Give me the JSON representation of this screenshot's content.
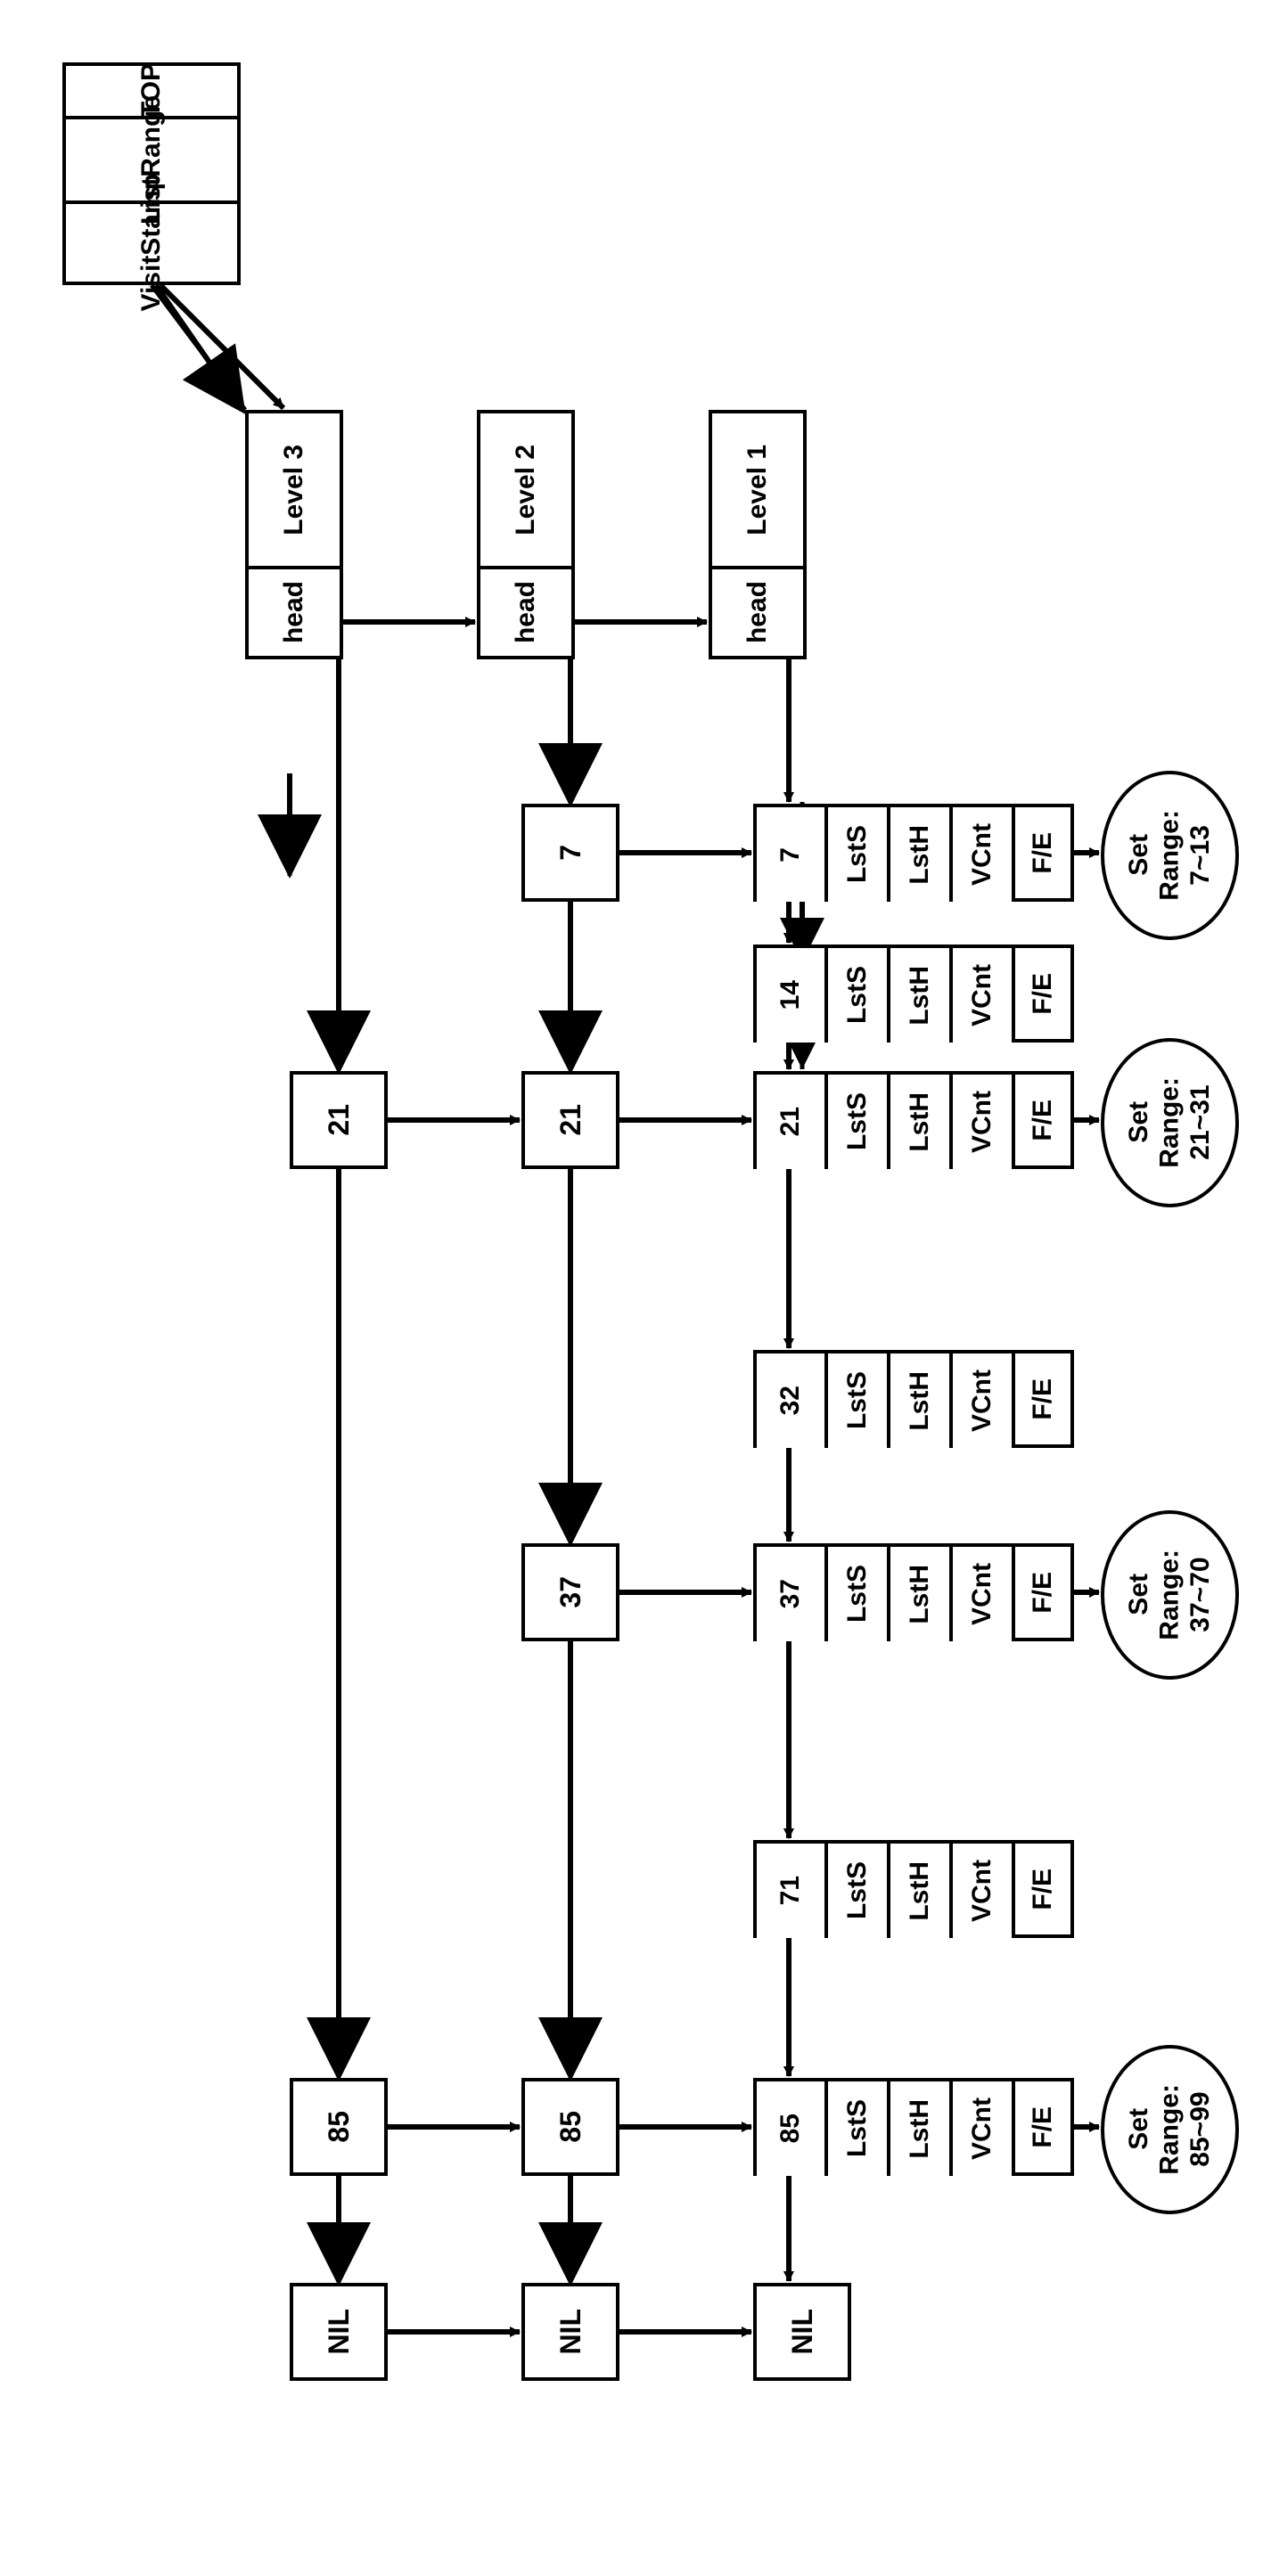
{
  "top_block": {
    "title": "TOP",
    "row1": "ListRange",
    "row2": "VisitStamp"
  },
  "levels": [
    {
      "label": "Level 3",
      "head": "head"
    },
    {
      "label": "Level 2",
      "head": "head"
    },
    {
      "label": "Level 1",
      "head": "head"
    }
  ],
  "nodes_l3": [
    "21",
    "85",
    "NIL"
  ],
  "nodes_l2": [
    "7",
    "21",
    "37",
    "85",
    "NIL"
  ],
  "nodes_l1_keys": [
    "7",
    "14",
    "21",
    "32",
    "37",
    "71",
    "85"
  ],
  "nodes_l1_nil": "NIL",
  "l1_fields": [
    "LstS",
    "LstH",
    "VCnt",
    "F/E"
  ],
  "ranges": [
    {
      "label1": "Set",
      "label2": "Range:",
      "label3": "7~13"
    },
    {
      "label1": "Set",
      "label2": "Range:",
      "label3": "21~31"
    },
    {
      "label1": "Set",
      "label2": "Range:",
      "label3": "37~70"
    },
    {
      "label1": "Set",
      "label2": "Range:",
      "label3": "85~99"
    }
  ]
}
